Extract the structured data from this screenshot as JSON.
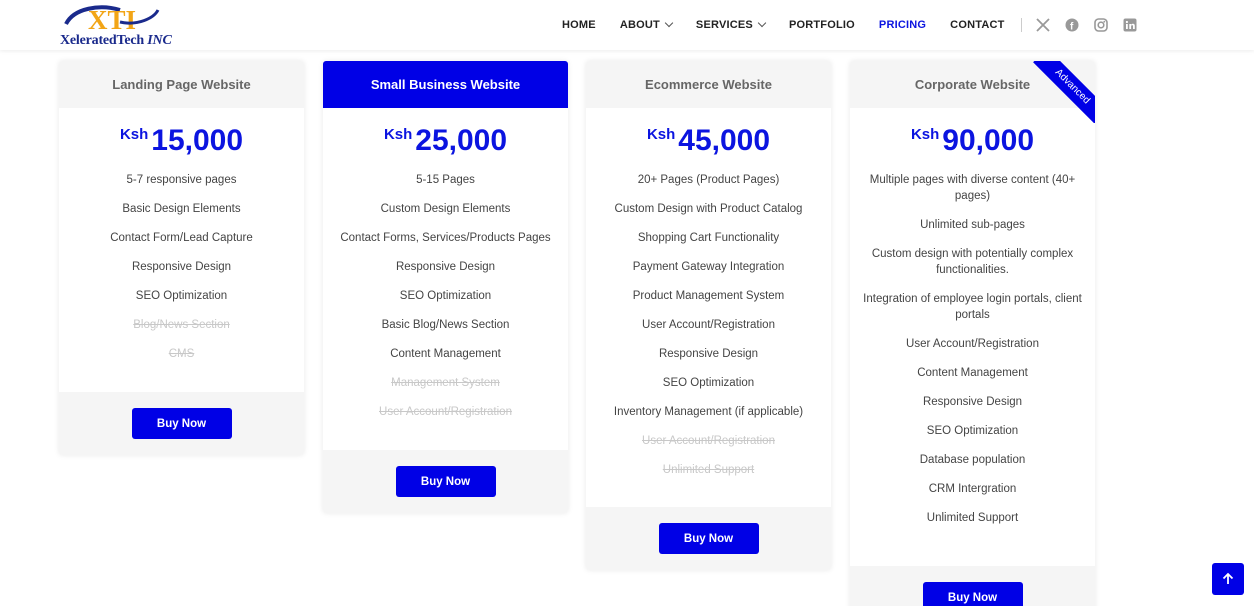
{
  "brand": {
    "logo_text": "XTI",
    "name_part1": "XeleratedTech",
    "name_part2": "INC",
    "colors": {
      "primary": "#0000e6",
      "logo_gold": "#f2a516",
      "logo_navy": "#1a2a8c"
    }
  },
  "nav": {
    "items": [
      {
        "label": "HOME",
        "has_dropdown": false,
        "active": false
      },
      {
        "label": "ABOUT",
        "has_dropdown": true,
        "active": false
      },
      {
        "label": "SERVICES",
        "has_dropdown": true,
        "active": false
      },
      {
        "label": "PORTFOLIO",
        "has_dropdown": false,
        "active": false
      },
      {
        "label": "PRICING",
        "has_dropdown": false,
        "active": true
      },
      {
        "label": "CONTACT",
        "has_dropdown": false,
        "active": false
      }
    ],
    "social_icons": [
      "x-icon",
      "facebook-icon",
      "instagram-icon",
      "linkedin-icon"
    ]
  },
  "plans": [
    {
      "title": "Landing Page Website",
      "currency": "Ksh",
      "price": "15,000",
      "featured": false,
      "ribbon": "",
      "features": [
        {
          "text": "5-7 responsive pages",
          "included": true
        },
        {
          "text": "Basic Design Elements",
          "included": true
        },
        {
          "text": "Contact Form/Lead Capture",
          "included": true
        },
        {
          "text": "Responsive Design",
          "included": true
        },
        {
          "text": "SEO Optimization",
          "included": true
        },
        {
          "text": "Blog/News Section",
          "included": false
        },
        {
          "text": "CMS",
          "included": false
        }
      ],
      "button": "Buy Now"
    },
    {
      "title": "Small Business Website",
      "currency": "Ksh",
      "price": "25,000",
      "featured": true,
      "ribbon": "",
      "features": [
        {
          "text": "5-15 Pages",
          "included": true
        },
        {
          "text": "Custom Design Elements",
          "included": true
        },
        {
          "text": "Contact Forms, Services/Products Pages",
          "included": true
        },
        {
          "text": "Responsive Design",
          "included": true
        },
        {
          "text": "SEO Optimization",
          "included": true
        },
        {
          "text": "Basic Blog/News Section",
          "included": true
        },
        {
          "text": "Content Management",
          "included": true
        },
        {
          "text": "Management System",
          "included": false
        },
        {
          "text": "User Account/Registration",
          "included": false
        }
      ],
      "button": "Buy Now"
    },
    {
      "title": "Ecommerce Website",
      "currency": "Ksh",
      "price": "45,000",
      "featured": false,
      "ribbon": "",
      "features": [
        {
          "text": "20+ Pages (Product Pages)",
          "included": true
        },
        {
          "text": "Custom Design with Product Catalog",
          "included": true
        },
        {
          "text": "Shopping Cart Functionality",
          "included": true
        },
        {
          "text": "Payment Gateway Integration",
          "included": true
        },
        {
          "text": "Product Management System",
          "included": true
        },
        {
          "text": "User Account/Registration",
          "included": true
        },
        {
          "text": "Responsive Design",
          "included": true
        },
        {
          "text": "SEO Optimization",
          "included": true
        },
        {
          "text": "Inventory Management (if applicable)",
          "included": true
        },
        {
          "text": "User Account/Registration",
          "included": false
        },
        {
          "text": "Unlimited Support",
          "included": false
        }
      ],
      "button": "Buy Now"
    },
    {
      "title": "Corporate Website",
      "currency": "Ksh",
      "price": "90,000",
      "featured": false,
      "ribbon": "Advanced",
      "features": [
        {
          "text": "Multiple pages with diverse content (40+ pages)",
          "included": true
        },
        {
          "text": "Unlimited sub-pages",
          "included": true
        },
        {
          "text": "Custom design with potentially complex functionalities.",
          "included": true
        },
        {
          "text": "Integration of employee login portals, client portals",
          "included": true
        },
        {
          "text": "User Account/Registration",
          "included": true
        },
        {
          "text": "Content Management",
          "included": true
        },
        {
          "text": "Responsive Design",
          "included": true
        },
        {
          "text": "SEO Optimization",
          "included": true
        },
        {
          "text": "Database population",
          "included": true
        },
        {
          "text": "CRM Intergration",
          "included": true
        },
        {
          "text": "Unlimited Support",
          "included": true
        }
      ],
      "button": "Buy Now"
    }
  ],
  "back_to_top_icon": "arrow-up-icon"
}
